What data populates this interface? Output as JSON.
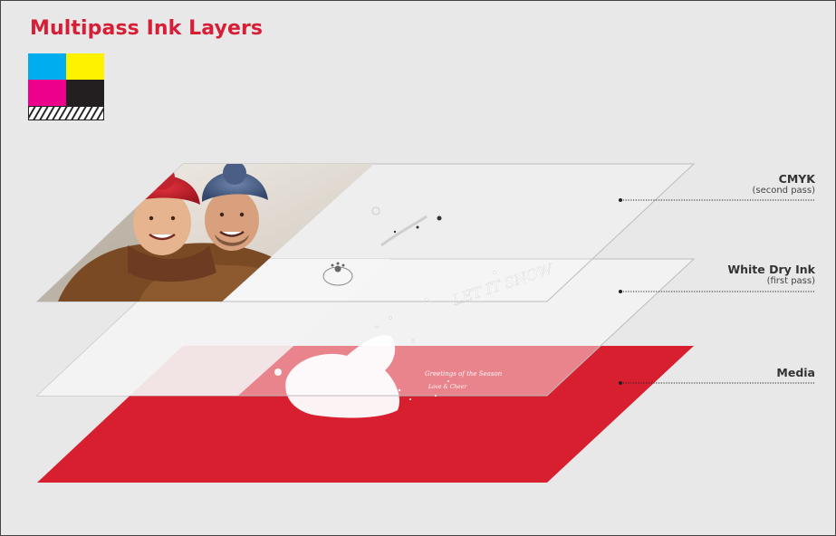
{
  "title": "Multipass Ink Layers",
  "colors": {
    "accent": "#d61f36",
    "cyan": "#00aeef",
    "yellow": "#fff200",
    "magenta": "#ec008c",
    "black": "#231f20"
  },
  "layers": [
    {
      "name": "CMYK",
      "subtitle": "(second pass)"
    },
    {
      "name": "White Dry Ink",
      "subtitle": "(first pass)"
    },
    {
      "name": "Media",
      "subtitle": ""
    }
  ],
  "card_text": {
    "let_it_snow": "LET IT SNOW",
    "greeting_line1": "Greetings of the Season",
    "greeting_line2": "Love & Cheer"
  }
}
